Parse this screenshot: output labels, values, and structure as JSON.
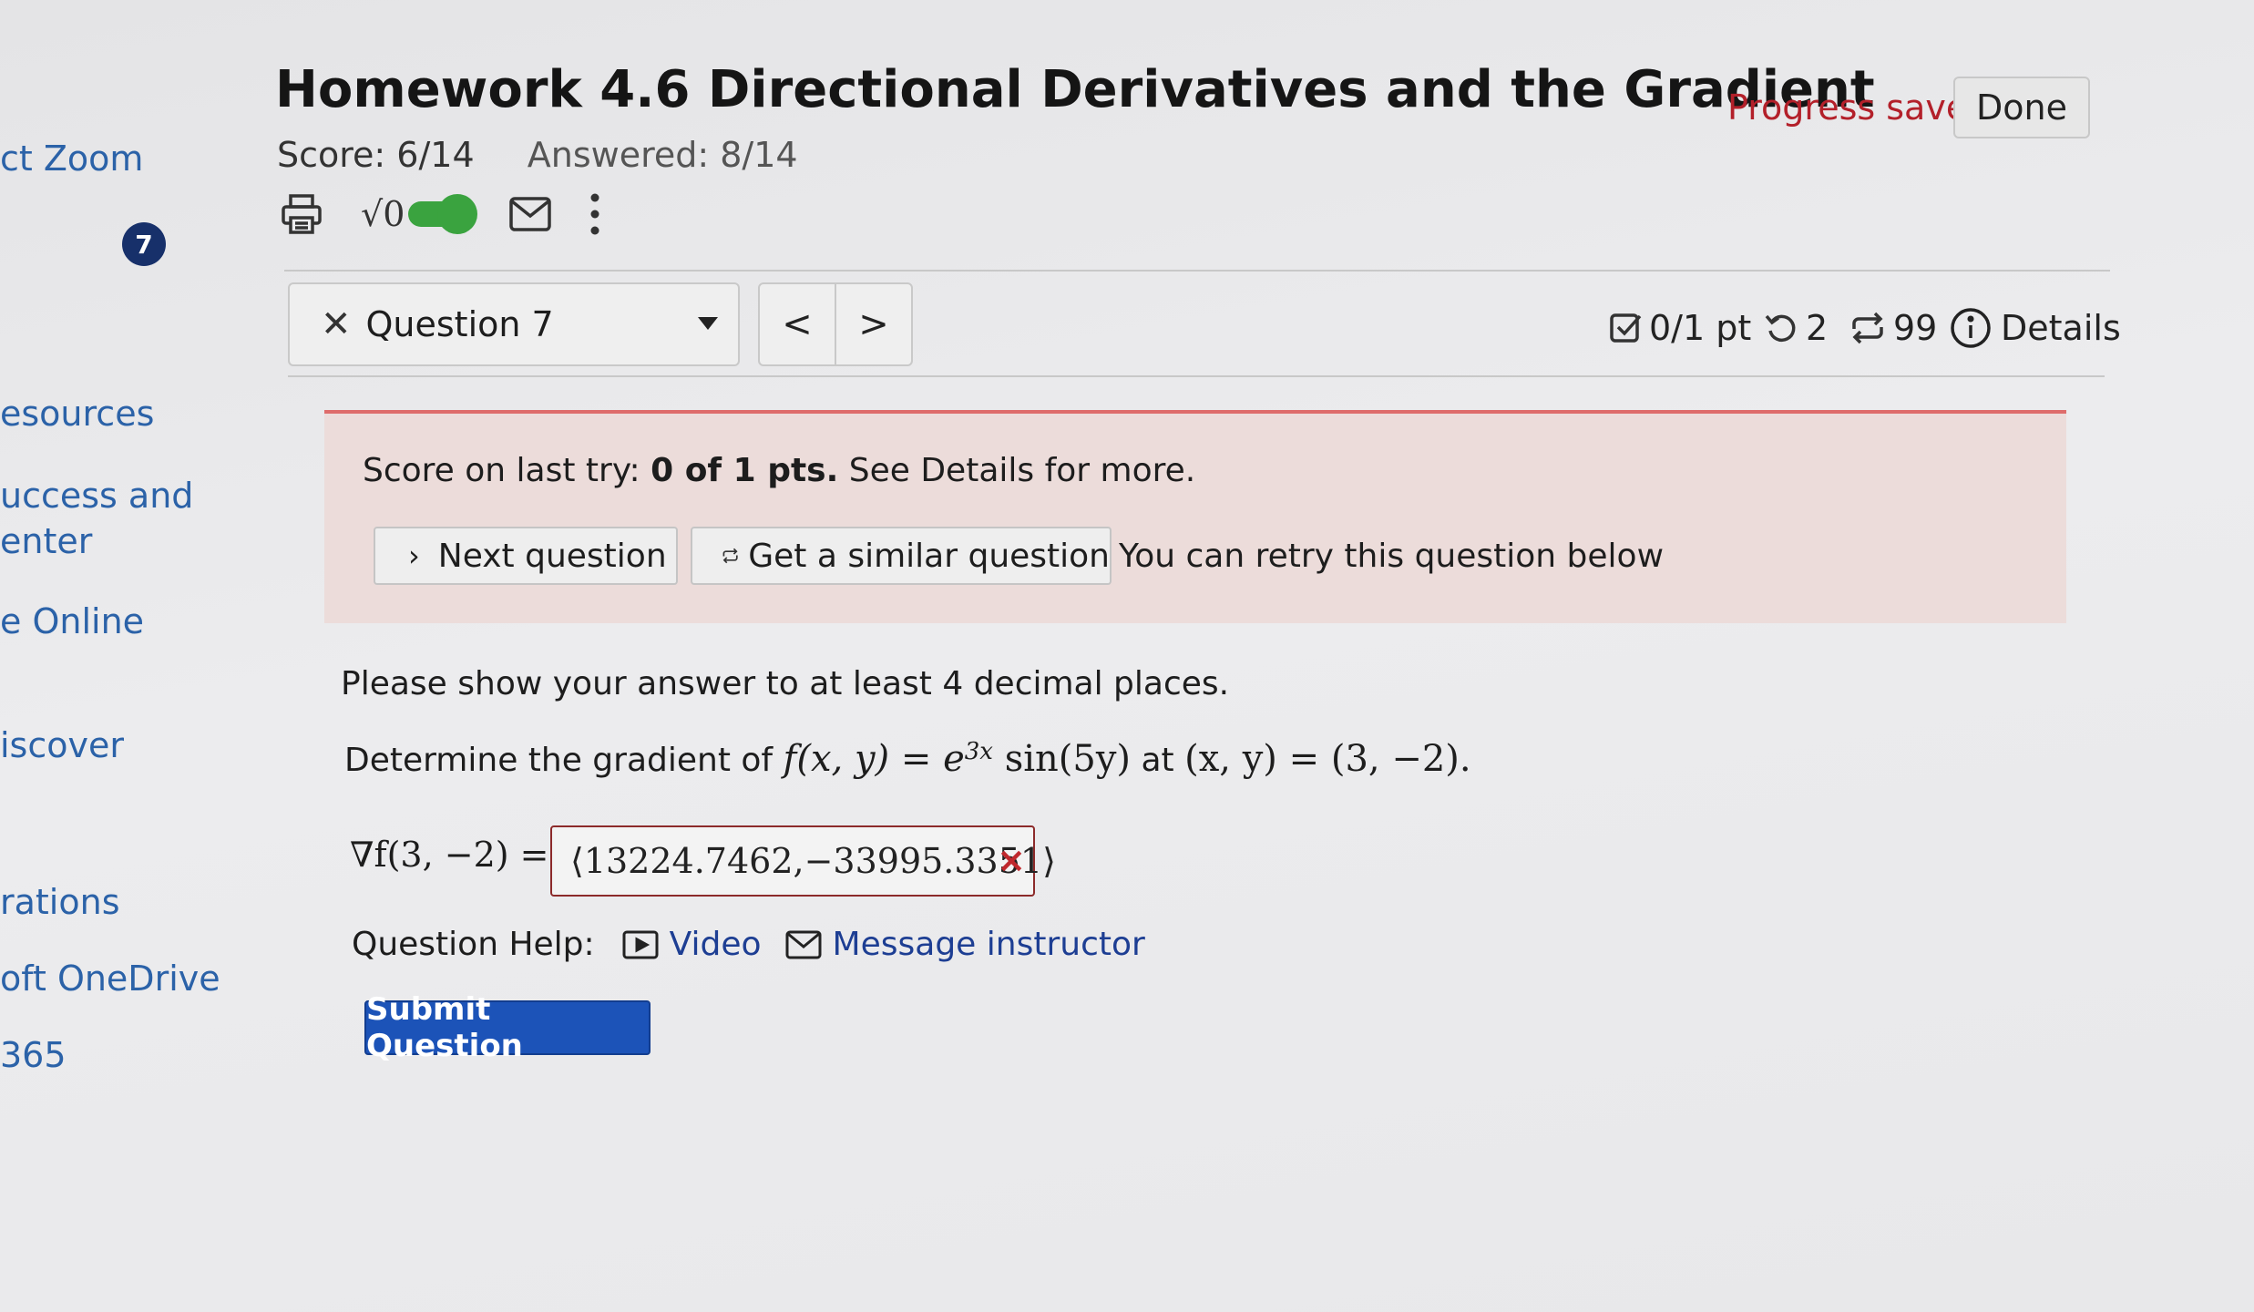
{
  "sidebar": {
    "items": [
      {
        "label": "ct Zoom"
      },
      {
        "label": "esources"
      },
      {
        "label": "uccess and"
      },
      {
        "label": "enter"
      },
      {
        "label": "e Online"
      },
      {
        "label": "iscover"
      },
      {
        "label": "rations"
      },
      {
        "label": "oft OneDrive"
      },
      {
        "label": "365"
      }
    ],
    "badge": "7"
  },
  "header": {
    "title": "Homework 4.6 Directional Derivatives and the Gradient",
    "score": "Score: 6/14",
    "answered": "Answered: 8/14",
    "progress_status": "Progress saved",
    "done_label": "Done",
    "icons": [
      "printer-icon",
      "sqrt-toggle-icon",
      "envelope-icon",
      "more-vertical-icon"
    ],
    "sqrt_label": "√0",
    "math_toggle_on": true
  },
  "question_nav": {
    "selected": "Question 7",
    "prev_label": "<",
    "next_label": ">",
    "points": "0/1 pt",
    "retries": "2",
    "attempts": "99",
    "details_label": "Details"
  },
  "feedback": {
    "prefix": "Score on last try: ",
    "score_bold": "0 of 1 pts.",
    "suffix": " See Details for more.",
    "next_question_label": "Next question",
    "similar_question_label": "Get a similar question",
    "retry_text": "You can retry this question below"
  },
  "question": {
    "instruction": "Please show your answer to at least 4 decimal places.",
    "prompt_prefix": "Determine the gradient of ",
    "function_lhs": "f(x, y) = e",
    "function_exp": "3x",
    "function_rest": " sin(5y)",
    "prompt_middle": " at ",
    "point": "(x, y) = (3, −2).",
    "answer_label": "∇f(3, −2) =",
    "answer_value": "⟨13224.7462,−33995.3351⟩",
    "answer_status": "×",
    "help_label": "Question Help:",
    "video_label": "Video",
    "message_label": "Message instructor",
    "submit_label": "Submit Question"
  },
  "colors": {
    "accent": "#1c53b8",
    "error": "#c0282d",
    "progress_saved": "#b3202a",
    "toggle_on": "#3aa33f",
    "feedback_bg": "#ecdcda",
    "feedback_border": "#de6c6b"
  }
}
